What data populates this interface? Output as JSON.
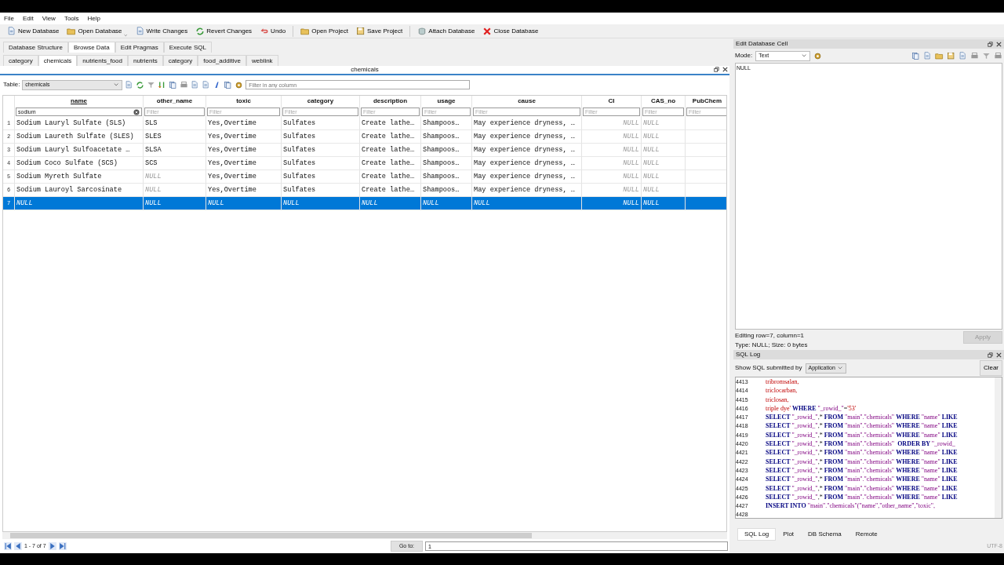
{
  "menu": [
    "File",
    "Edit",
    "View",
    "Tools",
    "Help"
  ],
  "toolbar": [
    {
      "label": "New Database",
      "menu": false
    },
    {
      "label": "Open Database",
      "menu": true
    },
    {
      "label": "Write Changes",
      "menu": false
    },
    {
      "label": "Revert Changes",
      "menu": false
    },
    {
      "label": "Undo",
      "menu": false
    },
    {
      "label": "Open Project",
      "menu": false
    },
    {
      "label": "Save Project",
      "menu": false
    },
    {
      "label": "Attach Database",
      "menu": false
    },
    {
      "label": "Close Database",
      "menu": false
    }
  ],
  "main_tabs": [
    {
      "label": "Database Structure",
      "selected": false
    },
    {
      "label": "Browse Data",
      "selected": true
    },
    {
      "label": "Edit Pragmas",
      "selected": false
    },
    {
      "label": "Execute SQL",
      "selected": false
    }
  ],
  "table_tabs": [
    {
      "label": "category",
      "selected": false
    },
    {
      "label": "chemicals",
      "selected": true
    },
    {
      "label": "nutrients_food",
      "selected": false
    },
    {
      "label": "nutrients",
      "selected": false
    },
    {
      "label": "category",
      "selected": false
    },
    {
      "label": "food_additive",
      "selected": false
    },
    {
      "label": "weblink",
      "selected": false
    }
  ],
  "browse": {
    "title": "chemicals",
    "table_label": "Table:",
    "table": "chemicals",
    "filter_placeholder": "Filter in any column",
    "columns": [
      {
        "name": "name",
        "filtered": true,
        "numeric": false,
        "filter": "sodium"
      },
      {
        "name": "other_name",
        "filtered": false,
        "numeric": false,
        "placeholder": "Filter"
      },
      {
        "name": "toxic",
        "filtered": false,
        "numeric": false,
        "placeholder": "Filter"
      },
      {
        "name": "category",
        "filtered": false,
        "numeric": false,
        "placeholder": "Filter"
      },
      {
        "name": "description",
        "filtered": false,
        "numeric": false,
        "placeholder": "Filter"
      },
      {
        "name": "usage",
        "filtered": false,
        "numeric": false,
        "placeholder": "Filter"
      },
      {
        "name": "cause",
        "filtered": false,
        "numeric": false,
        "placeholder": "Filter"
      },
      {
        "name": "CI",
        "filtered": false,
        "numeric": true,
        "placeholder": "Filter"
      },
      {
        "name": "CAS_no",
        "filtered": false,
        "numeric": false,
        "placeholder": "Filter"
      },
      {
        "name": "PubChem",
        "filtered": false,
        "numeric": true,
        "placeholder": "Filter"
      }
    ],
    "rows": [
      {
        "num": "1",
        "selected": false,
        "cells": [
          {
            "text": "Sodium Lauryl Sulfate (SLS)",
            "null": false
          },
          {
            "text": "SLS",
            "null": false
          },
          {
            "text": "Yes,Overtime",
            "null": false
          },
          {
            "text": "Sulfates",
            "null": false
          },
          {
            "text": "Create lathe…",
            "null": false
          },
          {
            "text": "Shampoos…",
            "null": false
          },
          {
            "text": "May experience dryness, …",
            "null": false
          },
          {
            "text": "NULL",
            "null": true
          },
          {
            "text": "NULL",
            "null": true
          }
        ]
      },
      {
        "num": "2",
        "selected": false,
        "cells": [
          {
            "text": "Sodium Laureth Sulfate (SLES)",
            "null": false
          },
          {
            "text": "SLES",
            "null": false
          },
          {
            "text": "Yes,Overtime",
            "null": false
          },
          {
            "text": "Sulfates",
            "null": false
          },
          {
            "text": "Create lathe…",
            "null": false
          },
          {
            "text": "Shampoos…",
            "null": false
          },
          {
            "text": "May experience dryness, …",
            "null": false
          },
          {
            "text": "NULL",
            "null": true
          },
          {
            "text": "NULL",
            "null": true
          }
        ]
      },
      {
        "num": "3",
        "selected": false,
        "cells": [
          {
            "text": "Sodium Lauryl Sulfoacetate …",
            "null": false
          },
          {
            "text": "SLSA",
            "null": false
          },
          {
            "text": "Yes,Overtime",
            "null": false
          },
          {
            "text": "Sulfates",
            "null": false
          },
          {
            "text": "Create lathe…",
            "null": false
          },
          {
            "text": "Shampoos…",
            "null": false
          },
          {
            "text": "May experience dryness, …",
            "null": false
          },
          {
            "text": "NULL",
            "null": true
          },
          {
            "text": "NULL",
            "null": true
          }
        ]
      },
      {
        "num": "4",
        "selected": false,
        "cells": [
          {
            "text": "Sodium Coco Sulfate (SCS)",
            "null": false
          },
          {
            "text": "SCS",
            "null": false
          },
          {
            "text": "Yes,Overtime",
            "null": false
          },
          {
            "text": "Sulfates",
            "null": false
          },
          {
            "text": "Create lathe…",
            "null": false
          },
          {
            "text": "Shampoos…",
            "null": false
          },
          {
            "text": "May experience dryness, …",
            "null": false
          },
          {
            "text": "NULL",
            "null": true
          },
          {
            "text": "NULL",
            "null": true
          }
        ]
      },
      {
        "num": "5",
        "selected": false,
        "cells": [
          {
            "text": "Sodium Myreth Sulfate",
            "null": false
          },
          {
            "text": "NULL",
            "null": true
          },
          {
            "text": "Yes,Overtime",
            "null": false
          },
          {
            "text": "Sulfates",
            "null": false
          },
          {
            "text": "Create lathe…",
            "null": false
          },
          {
            "text": "Shampoos…",
            "null": false
          },
          {
            "text": "May experience dryness, …",
            "null": false
          },
          {
            "text": "NULL",
            "null": true
          },
          {
            "text": "NULL",
            "null": true
          }
        ]
      },
      {
        "num": "6",
        "selected": false,
        "cells": [
          {
            "text": "Sodium Lauroyl Sarcosinate",
            "null": false
          },
          {
            "text": "NULL",
            "null": true
          },
          {
            "text": "Yes,Overtime",
            "null": false
          },
          {
            "text": "Sulfates",
            "null": false
          },
          {
            "text": "Create lathe…",
            "null": false
          },
          {
            "text": "Shampoos…",
            "null": false
          },
          {
            "text": "May experience dryness, …",
            "null": false
          },
          {
            "text": "NULL",
            "null": true
          },
          {
            "text": "NULL",
            "null": true
          }
        ]
      },
      {
        "num": "7",
        "selected": true,
        "cells": [
          {
            "text": "NULL",
            "null": true
          },
          {
            "text": "NULL",
            "null": true
          },
          {
            "text": "NULL",
            "null": true
          },
          {
            "text": "NULL",
            "null": true
          },
          {
            "text": "NULL",
            "null": true
          },
          {
            "text": "NULL",
            "null": true
          },
          {
            "text": "NULL",
            "null": true
          },
          {
            "text": "NULL",
            "null": true
          },
          {
            "text": "NULL",
            "null": true
          }
        ]
      }
    ],
    "pager": "1 - 7 of 7",
    "goto_label": "Go to:",
    "goto_value": "1"
  },
  "edit_cell": {
    "title": "Edit Database Cell",
    "mode_label": "Mode:",
    "mode": "Text",
    "content": "NULL",
    "status": [
      "Editing row=7, column=1",
      "Type: NULL; Size: 0 bytes"
    ],
    "apply": {
      "label": "Apply",
      "disabled": true
    }
  },
  "sql_log": {
    "title": "SQL Log",
    "source_label": "Show SQL submitted by",
    "source": "Application",
    "clear": "Clear",
    "lines": [
      {
        "num": "4413",
        "parts": [
          {
            "kind": "str",
            "text": "tribromsalan,"
          }
        ]
      },
      {
        "num": "4414",
        "parts": [
          {
            "kind": "str",
            "text": "triclocarban,"
          }
        ]
      },
      {
        "num": "4415",
        "parts": [
          {
            "kind": "str",
            "text": "triclosan,"
          }
        ]
      },
      {
        "num": "4416",
        "parts": [
          {
            "kind": "str",
            "text": "triple dye' "
          },
          {
            "kind": "kw",
            "text": "WHERE "
          },
          {
            "kind": "id",
            "text": "\"_rowid_\""
          },
          {
            "kind": "plain",
            "text": "="
          },
          {
            "kind": "str",
            "text": "'53'"
          }
        ]
      },
      {
        "num": "4417",
        "parts": [
          {
            "kind": "kw",
            "text": "SELECT "
          },
          {
            "kind": "id",
            "text": "\"_rowid_\""
          },
          {
            "kind": "plain",
            "text": ",* "
          },
          {
            "kind": "kw",
            "text": "FROM "
          },
          {
            "kind": "id",
            "text": "\"main\".\"chemicals\" "
          },
          {
            "kind": "kw",
            "text": "WHERE "
          },
          {
            "kind": "id",
            "text": "\"name\" "
          },
          {
            "kind": "kw",
            "text": "LIKE"
          }
        ]
      },
      {
        "num": "4418",
        "parts": [
          {
            "kind": "kw",
            "text": "SELECT "
          },
          {
            "kind": "id",
            "text": "\"_rowid_\""
          },
          {
            "kind": "plain",
            "text": ",* "
          },
          {
            "kind": "kw",
            "text": "FROM "
          },
          {
            "kind": "id",
            "text": "\"main\".\"chemicals\" "
          },
          {
            "kind": "kw",
            "text": "WHERE "
          },
          {
            "kind": "id",
            "text": "\"name\" "
          },
          {
            "kind": "kw",
            "text": "LIKE"
          }
        ]
      },
      {
        "num": "4419",
        "parts": [
          {
            "kind": "kw",
            "text": "SELECT "
          },
          {
            "kind": "id",
            "text": "\"_rowid_\""
          },
          {
            "kind": "plain",
            "text": ",* "
          },
          {
            "kind": "kw",
            "text": "FROM "
          },
          {
            "kind": "id",
            "text": "\"main\".\"chemicals\" "
          },
          {
            "kind": "kw",
            "text": "WHERE "
          },
          {
            "kind": "id",
            "text": "\"name\" "
          },
          {
            "kind": "kw",
            "text": "LIKE"
          }
        ]
      },
      {
        "num": "4420",
        "parts": [
          {
            "kind": "kw",
            "text": "SELECT "
          },
          {
            "kind": "id",
            "text": "\"_rowid_\""
          },
          {
            "kind": "plain",
            "text": ",* "
          },
          {
            "kind": "kw",
            "text": "FROM "
          },
          {
            "kind": "id",
            "text": "\"main\".\"chemicals\"  "
          },
          {
            "kind": "kw",
            "text": "ORDER BY "
          },
          {
            "kind": "id",
            "text": "\"_rowid_"
          }
        ]
      },
      {
        "num": "4421",
        "parts": [
          {
            "kind": "kw",
            "text": "SELECT "
          },
          {
            "kind": "id",
            "text": "\"_rowid_\""
          },
          {
            "kind": "plain",
            "text": ",* "
          },
          {
            "kind": "kw",
            "text": "FROM "
          },
          {
            "kind": "id",
            "text": "\"main\".\"chemicals\" "
          },
          {
            "kind": "kw",
            "text": "WHERE "
          },
          {
            "kind": "id",
            "text": "\"name\" "
          },
          {
            "kind": "kw",
            "text": "LIKE"
          }
        ]
      },
      {
        "num": "4422",
        "parts": [
          {
            "kind": "kw",
            "text": "SELECT "
          },
          {
            "kind": "id",
            "text": "\"_rowid_\""
          },
          {
            "kind": "plain",
            "text": ",* "
          },
          {
            "kind": "kw",
            "text": "FROM "
          },
          {
            "kind": "id",
            "text": "\"main\".\"chemicals\" "
          },
          {
            "kind": "kw",
            "text": "WHERE "
          },
          {
            "kind": "id",
            "text": "\"name\" "
          },
          {
            "kind": "kw",
            "text": "LIKE"
          }
        ]
      },
      {
        "num": "4423",
        "parts": [
          {
            "kind": "kw",
            "text": "SELECT "
          },
          {
            "kind": "id",
            "text": "\"_rowid_\""
          },
          {
            "kind": "plain",
            "text": ",* "
          },
          {
            "kind": "kw",
            "text": "FROM "
          },
          {
            "kind": "id",
            "text": "\"main\".\"chemicals\" "
          },
          {
            "kind": "kw",
            "text": "WHERE "
          },
          {
            "kind": "id",
            "text": "\"name\" "
          },
          {
            "kind": "kw",
            "text": "LIKE"
          }
        ]
      },
      {
        "num": "4424",
        "parts": [
          {
            "kind": "kw",
            "text": "SELECT "
          },
          {
            "kind": "id",
            "text": "\"_rowid_\""
          },
          {
            "kind": "plain",
            "text": ",* "
          },
          {
            "kind": "kw",
            "text": "FROM "
          },
          {
            "kind": "id",
            "text": "\"main\".\"chemicals\" "
          },
          {
            "kind": "kw",
            "text": "WHERE "
          },
          {
            "kind": "id",
            "text": "\"name\" "
          },
          {
            "kind": "kw",
            "text": "LIKE"
          }
        ]
      },
      {
        "num": "4425",
        "parts": [
          {
            "kind": "kw",
            "text": "SELECT "
          },
          {
            "kind": "id",
            "text": "\"_rowid_\""
          },
          {
            "kind": "plain",
            "text": ",* "
          },
          {
            "kind": "kw",
            "text": "FROM "
          },
          {
            "kind": "id",
            "text": "\"main\".\"chemicals\" "
          },
          {
            "kind": "kw",
            "text": "WHERE "
          },
          {
            "kind": "id",
            "text": "\"name\" "
          },
          {
            "kind": "kw",
            "text": "LIKE"
          }
        ]
      },
      {
        "num": "4426",
        "parts": [
          {
            "kind": "kw",
            "text": "SELECT "
          },
          {
            "kind": "id",
            "text": "\"_rowid_\""
          },
          {
            "kind": "plain",
            "text": ",* "
          },
          {
            "kind": "kw",
            "text": "FROM "
          },
          {
            "kind": "id",
            "text": "\"main\".\"chemicals\" "
          },
          {
            "kind": "kw",
            "text": "WHERE "
          },
          {
            "kind": "id",
            "text": "\"name\" "
          },
          {
            "kind": "kw",
            "text": "LIKE"
          }
        ]
      },
      {
        "num": "4427",
        "parts": [
          {
            "kind": "kw",
            "text": "INSERT INTO "
          },
          {
            "kind": "id",
            "text": "\"main\".\"chemicals\"(\"name\",\"other_name\",\"toxic\","
          }
        ]
      },
      {
        "num": "4428"
      }
    ]
  },
  "bottom_tabs": [
    {
      "label": "SQL Log",
      "selected": true
    },
    {
      "label": "Plot",
      "selected": false
    },
    {
      "label": "DB Schema",
      "selected": false
    },
    {
      "label": "Remote",
      "selected": false
    }
  ],
  "status_bar": "UTF-8"
}
